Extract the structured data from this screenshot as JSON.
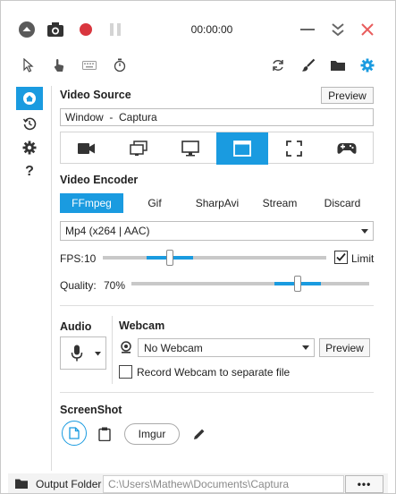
{
  "titlebar": {
    "timer": "00:00:00",
    "icons": [
      "up-arrow-circle-icon",
      "camera-icon",
      "record-icon",
      "pause-icon",
      "minimize-icon",
      "collapse-chevrons-icon",
      "close-icon"
    ]
  },
  "toolbar": {
    "left_icons": [
      "pointer-icon",
      "hand-click-icon",
      "keyboard-icon",
      "stopwatch-icon"
    ],
    "right_icons": [
      "refresh-icon",
      "brush-icon",
      "folder-icon",
      "settings-gear-icon"
    ]
  },
  "sidebar": {
    "items": [
      "home-icon",
      "history-icon",
      "settings-icon",
      "help-icon"
    ],
    "help_label": "?"
  },
  "video_source": {
    "heading": "Video Source",
    "preview_label": "Preview",
    "value": "Window  -  Captura",
    "sources": [
      "video-camera-icon",
      "multiple-screens-icon",
      "monitor-icon",
      "window-icon",
      "region-icon",
      "gamepad-icon"
    ],
    "active_index": 3
  },
  "video_encoder": {
    "heading": "Video Encoder",
    "tabs": [
      "FFmpeg",
      "Gif",
      "SharpAvi",
      "Stream",
      "Discard"
    ],
    "active_tab": 0,
    "codec": "Mp4 (x264 | AAC)",
    "fps_label": "FPS:",
    "fps_value": "10",
    "limit_label": "Limit",
    "limit_checked": true,
    "quality_label": "Quality:",
    "quality_value": "70%",
    "fps_fraction": 0.3,
    "quality_fraction": 0.7
  },
  "audio": {
    "heading": "Audio"
  },
  "webcam": {
    "heading": "Webcam",
    "selected": "No Webcam",
    "preview_label": "Preview",
    "record_separate_label": "Record Webcam to separate file"
  },
  "screenshot": {
    "heading": "ScreenShot",
    "imgur_label": "Imgur"
  },
  "footer": {
    "output_label": "Output Folder",
    "output_path": "C:\\Users\\Mathew\\Documents\\Captura",
    "more_label": "•••"
  },
  "colors": {
    "accent": "#1a9be0",
    "record": "#d9363e",
    "close": "#e85d5d",
    "icon": "#3a3a3a"
  }
}
